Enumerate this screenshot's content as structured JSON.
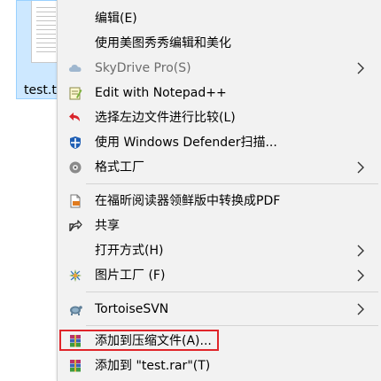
{
  "desktop": {
    "file_label": "test.t"
  },
  "menu": {
    "items": [
      {
        "label": "编辑(E)"
      },
      {
        "label": "使用美图秀秀编辑和美化"
      },
      {
        "label": "SkyDrive Pro(S)"
      },
      {
        "label": "Edit with Notepad++"
      },
      {
        "label": "选择左边文件进行比较(L)"
      },
      {
        "label": "使用 Windows Defender扫描..."
      },
      {
        "label": "格式工厂"
      },
      {
        "label": "在福昕阅读器领鲜版中转换成PDF"
      },
      {
        "label": "共享"
      },
      {
        "label": "打开方式(H)"
      },
      {
        "label": "图片工厂 (F)"
      },
      {
        "label": "TortoiseSVN"
      },
      {
        "label": "添加到压缩文件(A)..."
      },
      {
        "label": "添加到 \"test.rar\"(T)"
      }
    ]
  },
  "colors": {
    "highlight_border": "#e0252a",
    "menu_background": "#f2f2f2",
    "selection_tile": "#cde8ff"
  }
}
